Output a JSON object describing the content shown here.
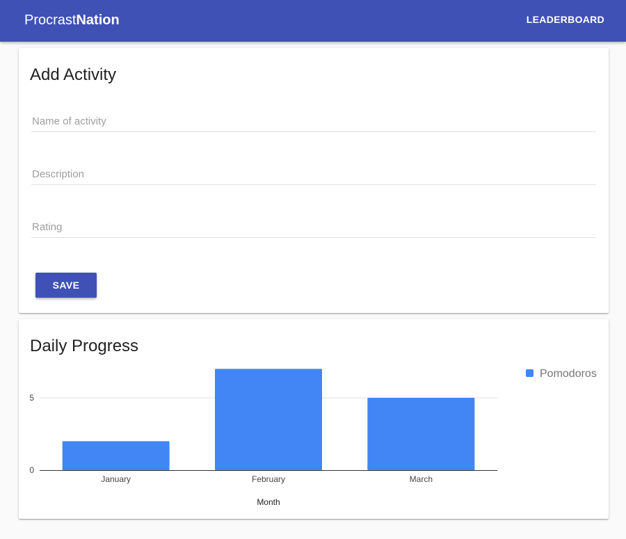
{
  "header": {
    "brand_prefix": "Procrast",
    "brand_suffix": "Nation",
    "nav_leaderboard": "LEADERBOARD",
    "color": "#3f51b5"
  },
  "add_activity": {
    "title": "Add Activity",
    "name_placeholder": "Name of activity",
    "name_value": "",
    "description_placeholder": "Description",
    "description_value": "",
    "rating_placeholder": "Rating",
    "rating_value": "",
    "save_label": "SAVE"
  },
  "daily_progress": {
    "title": "Daily Progress"
  },
  "chart_data": {
    "type": "bar",
    "categories": [
      "January",
      "February",
      "March"
    ],
    "series": [
      {
        "name": "Pomodoros",
        "values": [
          2,
          7,
          5
        ],
        "color": "#4285f4"
      }
    ],
    "xlabel": "Month",
    "ylabel": "",
    "yticks": [
      0,
      5
    ],
    "ylim": [
      0,
      7
    ],
    "grid": true,
    "legend_position": "right"
  }
}
